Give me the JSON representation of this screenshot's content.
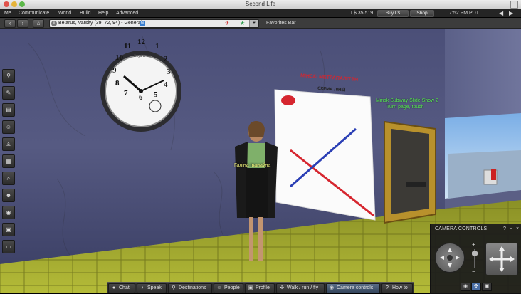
{
  "window": {
    "title": "Second Life"
  },
  "menu": {
    "items": [
      "Me",
      "Communicate",
      "World",
      "Build",
      "Help",
      "Advanced"
    ]
  },
  "status": {
    "balance": "L$ 35,519",
    "buy_label": "Buy L$",
    "shop_label": "Shop",
    "time": "7:52 PM PDT"
  },
  "nav": {
    "location": "Belarus, Varsity (39, 72, 94) - General",
    "rating_badge": "G",
    "favorites_label": "Favorites Bar"
  },
  "scene": {
    "avatar_name": "Галіна Іванаўна",
    "slideshow_title": "Minsk Subway Slide Show 2",
    "slideshow_subtitle": "Turn page, touch",
    "clock_brand": "Boyd & Ido",
    "clock_numerals": [
      "12",
      "1",
      "2",
      "3",
      "4",
      "5",
      "6",
      "7",
      "8",
      "9",
      "10",
      "11"
    ],
    "poster_title": "МІНСКІ МЕТРАПАЛІТЭН",
    "poster_subtitle": "СХЕМА ЛІНІЙ"
  },
  "sidebar": {
    "icons": [
      "gesture-icon",
      "pin-icon",
      "map-icon",
      "people-icon",
      "outfit-icon",
      "inventory-icon",
      "search-icon",
      "appearance-icon",
      "voice-icon",
      "snapshot-icon",
      "chat-bubble-icon"
    ]
  },
  "bottombar": {
    "buttons": [
      {
        "label": "Chat",
        "icon": "chat-icon"
      },
      {
        "label": "Speak",
        "icon": "microphone-icon"
      },
      {
        "label": "Destinations",
        "icon": "destination-pin-icon"
      },
      {
        "label": "People",
        "icon": "people-icon"
      },
      {
        "label": "Profile",
        "icon": "profile-icon"
      },
      {
        "label": "Walk / run / fly",
        "icon": "walk-icon"
      },
      {
        "label": "Camera controls",
        "icon": "eye-icon"
      },
      {
        "label": "How to",
        "icon": "help-icon"
      }
    ]
  },
  "camera_panel": {
    "title": "CAMERA CONTROLS",
    "help": "?",
    "minimize": "−",
    "close": "×",
    "zoom_plus": "+",
    "zoom_minus": "−"
  },
  "colors": {
    "accent": "#4a6fa5",
    "metro_red": "#d6262f",
    "metro_blue": "#2b3fb5",
    "floor": "#9aa12c",
    "nametag_green": "#5ff05f",
    "nametag_yellow": "#f2f27a"
  }
}
